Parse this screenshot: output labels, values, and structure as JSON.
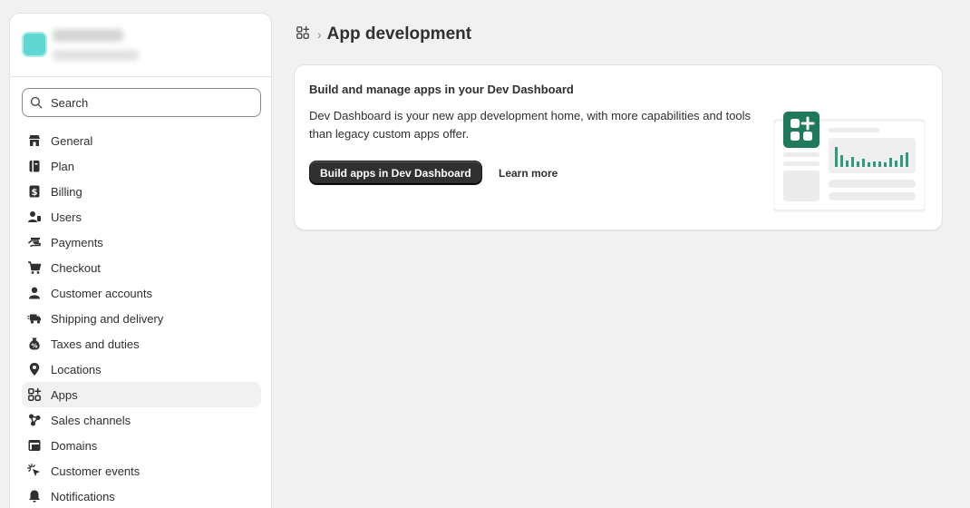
{
  "sidebar": {
    "search_placeholder": "Search",
    "items": [
      {
        "label": "General",
        "icon": "store-icon"
      },
      {
        "label": "Plan",
        "icon": "plan-icon"
      },
      {
        "label": "Billing",
        "icon": "billing-icon"
      },
      {
        "label": "Users",
        "icon": "users-icon"
      },
      {
        "label": "Payments",
        "icon": "payments-icon"
      },
      {
        "label": "Checkout",
        "icon": "cart-icon"
      },
      {
        "label": "Customer accounts",
        "icon": "person-icon"
      },
      {
        "label": "Shipping and delivery",
        "icon": "truck-icon"
      },
      {
        "label": "Taxes and duties",
        "icon": "tax-icon"
      },
      {
        "label": "Locations",
        "icon": "location-pin-icon"
      },
      {
        "label": "Apps",
        "icon": "apps-icon",
        "active": true
      },
      {
        "label": "Sales channels",
        "icon": "sales-channels-icon"
      },
      {
        "label": "Domains",
        "icon": "domains-icon"
      },
      {
        "label": "Customer events",
        "icon": "cursor-click-icon"
      },
      {
        "label": "Notifications",
        "icon": "bell-icon"
      }
    ]
  },
  "breadcrumb": {
    "icon": "apps-icon",
    "separator": "›",
    "title": "App development"
  },
  "card": {
    "title": "Build and manage apps in your Dev Dashboard",
    "description": "Dev Dashboard is your new app development home, with more capabilities and tools than legacy custom apps offer.",
    "primary_button": "Build apps in Dev Dashboard",
    "secondary_button": "Learn more"
  },
  "colors": {
    "brand_green": "#1f7a5c",
    "bar_green": "#2f9a7c",
    "active_bg": "#f1f1f1",
    "primary_button_bg": "#303030"
  }
}
